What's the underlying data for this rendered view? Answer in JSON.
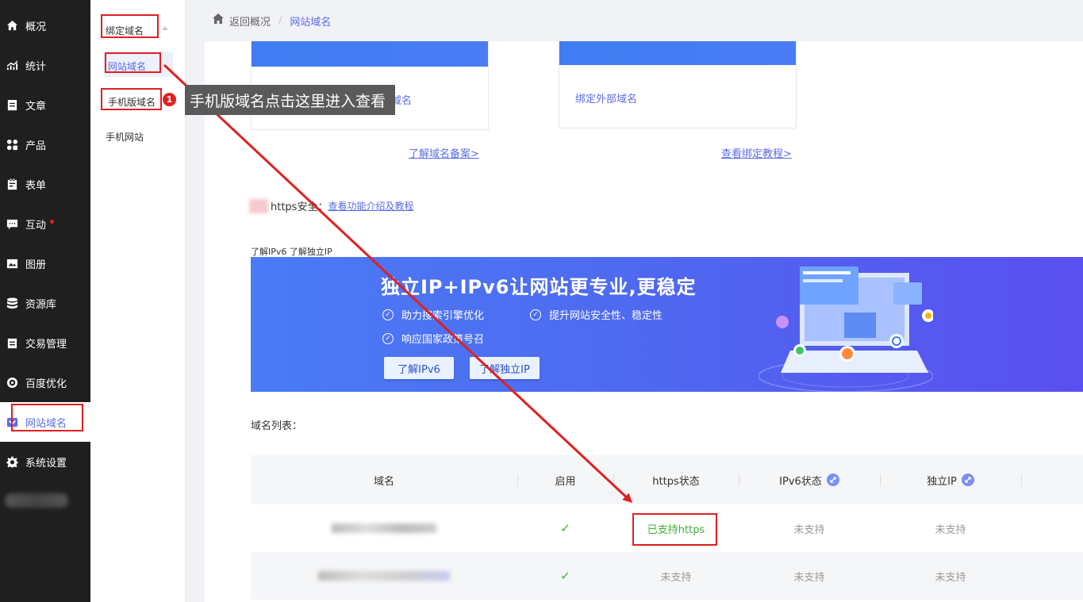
{
  "nav": {
    "items": [
      {
        "label": "概况",
        "icon": "home-icon"
      },
      {
        "label": "统计",
        "icon": "stats-icon"
      },
      {
        "label": "文章",
        "icon": "article-icon"
      },
      {
        "label": "产品",
        "icon": "product-icon"
      },
      {
        "label": "表单",
        "icon": "form-icon"
      },
      {
        "label": "互动",
        "icon": "chat-icon"
      },
      {
        "label": "图册",
        "icon": "album-icon"
      },
      {
        "label": "资源库",
        "icon": "database-icon"
      },
      {
        "label": "交易管理",
        "icon": "trade-icon"
      },
      {
        "label": "百度优化",
        "icon": "seo-icon"
      },
      {
        "label": "网站域名",
        "icon": "domain-icon"
      },
      {
        "label": "系统设置",
        "icon": "gear-icon"
      }
    ],
    "active": "网站域名"
  },
  "submenu": {
    "group": "绑定域名",
    "items": [
      "网站域名",
      "手机版域名",
      "手机网站"
    ],
    "selected": "网站域名"
  },
  "breadcrumb": {
    "back": "返回概况",
    "separator": "/",
    "current": "网站域名"
  },
  "cards": [
    {
      "text": "域名",
      "link": "了解域名备案>"
    },
    {
      "text": "绑定外部域名",
      "link": "查看绑定教程>"
    }
  ],
  "https": {
    "label": "https安全：",
    "link": "查看功能介绍及教程"
  },
  "learn_line": "了解IPv6 了解独立IP",
  "promo": {
    "title": "独立IP+IPv6让网站更专业,更稳定",
    "points": [
      "助力搜索引擎优化",
      "提升网站安全性、稳定性",
      "响应国家政策号召"
    ],
    "buttons": [
      "了解IPv6",
      "了解独立IP"
    ],
    "colors": {
      "from": "#4a7bf5",
      "to": "#5a4ff0"
    }
  },
  "domain_list": {
    "title": "域名列表：",
    "headers": [
      "域名",
      "启用",
      "https状态",
      "IPv6状态",
      "独立IP"
    ],
    "rows": [
      {
        "enabled": "✓",
        "https": "已支持https",
        "ipv6": "未支持",
        "ip": "未支持"
      },
      {
        "enabled": "✓",
        "https": "未支持",
        "ipv6": "未支持",
        "ip": "未支持"
      }
    ]
  },
  "annotation": {
    "badge": "1",
    "tooltip": "手机版域名点击这里进入查看",
    "color": "#e02020"
  },
  "colors": {
    "accent": "#5b6de8",
    "success": "#3aaf3a",
    "nav_bg": "#1f1f1f"
  }
}
